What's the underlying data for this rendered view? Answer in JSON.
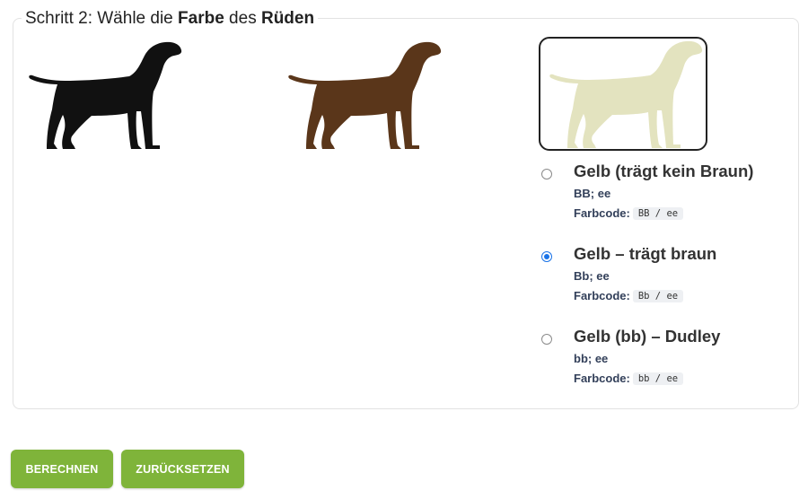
{
  "step": {
    "prefix": "Schritt 2: Wähle die ",
    "bold1": "Farbe",
    "middle": " des ",
    "bold2": "Rüden"
  },
  "dogs": [
    {
      "icon": "dog-silhouette-icon",
      "color": "#111111"
    },
    {
      "icon": "dog-silhouette-icon",
      "color": "#5a361a"
    },
    {
      "icon": "dog-silhouette-icon",
      "color": "#e3e3bf",
      "selected": true
    }
  ],
  "options": [
    {
      "title": "Gelb (trägt kein Braun)",
      "genotype": "BB; ee",
      "code_label": "Farbcode:",
      "code": "BB / ee",
      "checked": false
    },
    {
      "title": "Gelb – trägt braun",
      "genotype": "Bb; ee",
      "code_label": "Farbcode:",
      "code": "Bb / ee",
      "checked": true
    },
    {
      "title": "Gelb (bb) – Dudley",
      "genotype": "bb; ee",
      "code_label": "Farbcode:",
      "code": "bb / ee",
      "checked": false
    }
  ],
  "buttons": {
    "calculate": "BERECHNEN",
    "reset": "ZURÜCKSETZEN"
  },
  "colors": {
    "accent_green": "#7fb43a",
    "radio_blue": "#1a73e8"
  }
}
